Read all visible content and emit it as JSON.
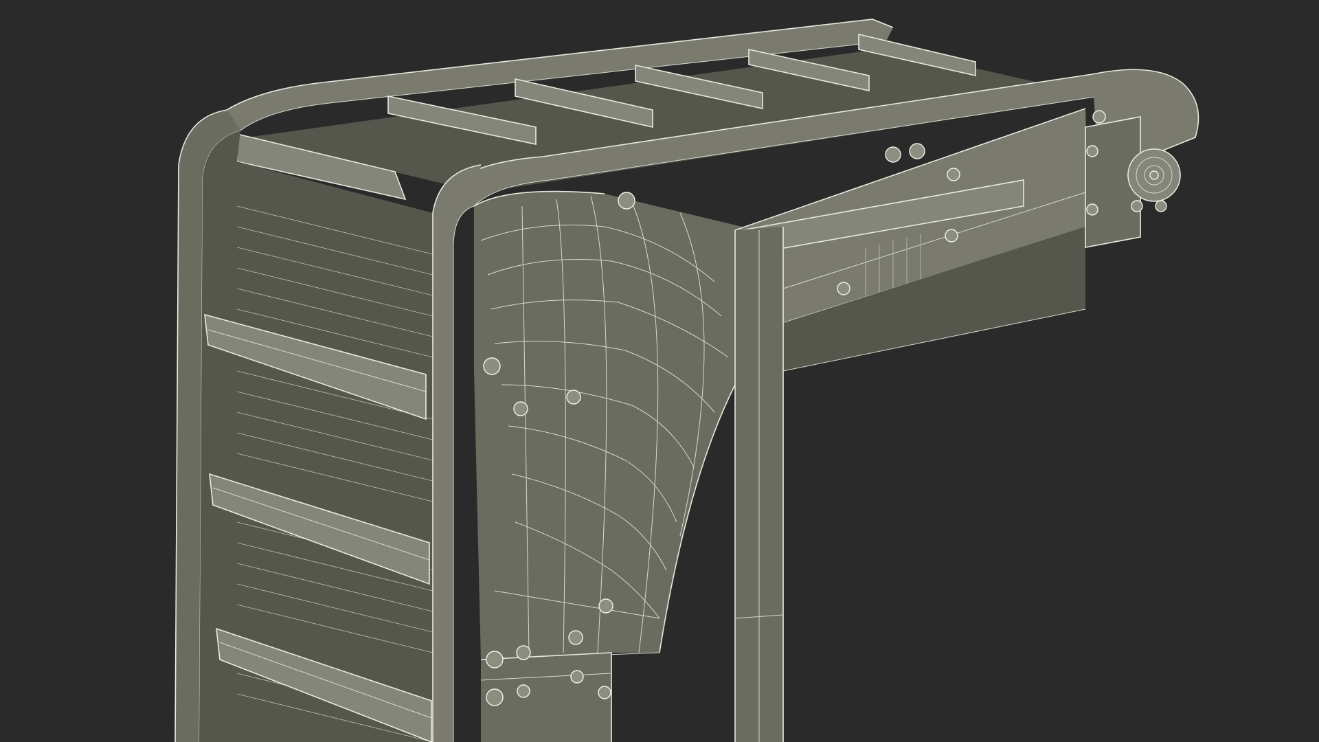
{
  "scene": {
    "subject": "wireframe-conveyor-model",
    "colors": {
      "background": "#2a2a2a",
      "surface": "#6b6c60",
      "surface_dark": "#55564c",
      "wire": "#e9eadf"
    }
  }
}
